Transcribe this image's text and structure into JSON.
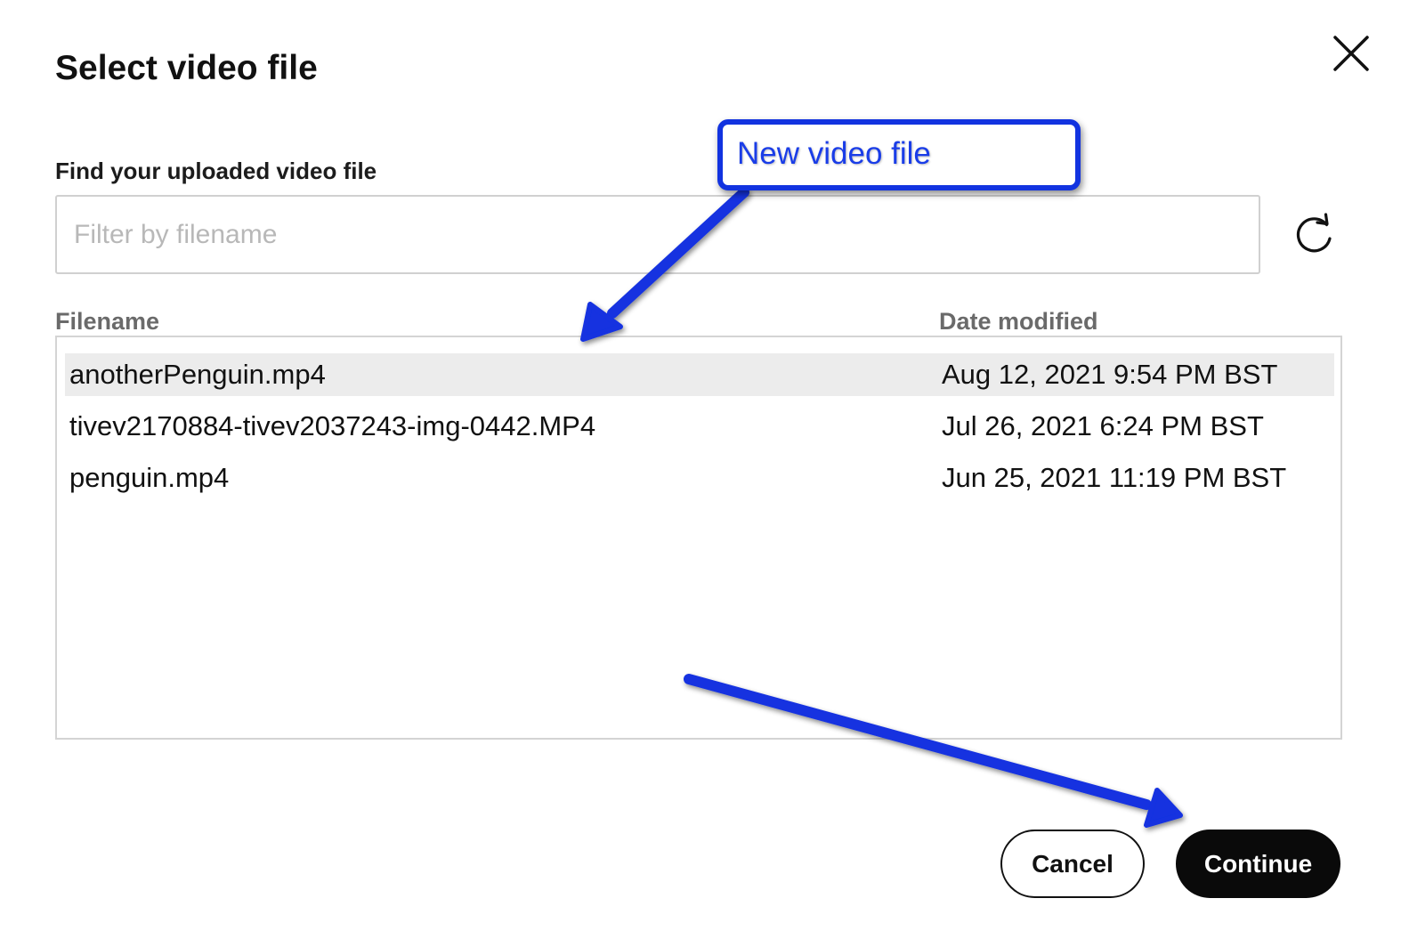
{
  "dialog": {
    "title": "Select video file",
    "close_icon": "close-icon"
  },
  "filter": {
    "label": "Find your uploaded video file",
    "placeholder": "Filter by filename",
    "value": "",
    "refresh_icon": "refresh-icon"
  },
  "table": {
    "headers": {
      "filename": "Filename",
      "date_modified": "Date modified"
    },
    "rows": [
      {
        "filename": "anotherPenguin.mp4",
        "date": "Aug 12, 2021 9:54 PM BST",
        "selected": true
      },
      {
        "filename": "tivev2170884-tivev2037243-img-0442.MP4",
        "date": "Jul 26, 2021 6:24 PM BST",
        "selected": false
      },
      {
        "filename": "penguin.mp4",
        "date": "Jun 25, 2021 11:19 PM BST",
        "selected": false
      }
    ]
  },
  "actions": {
    "cancel_label": "Cancel",
    "continue_label": "Continue"
  },
  "annotation": {
    "callout_text": "New video file",
    "color": "#1233e0"
  },
  "colors": {
    "selected_row": "#ececec",
    "primary_button": "#0a0a0a",
    "border": "#d4d4d4"
  }
}
